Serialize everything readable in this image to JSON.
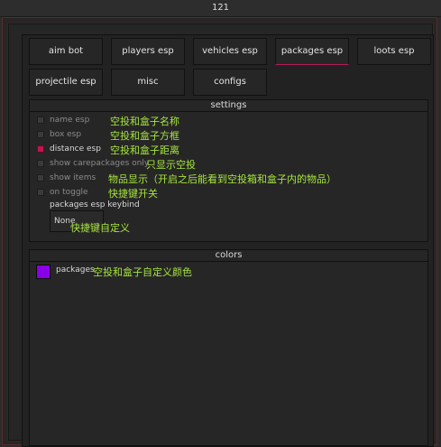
{
  "window": {
    "title": "121"
  },
  "tabs": [
    {
      "label": "aim bot"
    },
    {
      "label": "players esp"
    },
    {
      "label": "vehicles esp"
    },
    {
      "label": "packages esp",
      "active": true
    },
    {
      "label": "loots esp"
    },
    {
      "label": "projectile esp"
    },
    {
      "label": "misc"
    },
    {
      "label": "configs"
    }
  ],
  "settings": {
    "title": "settings",
    "items": [
      {
        "label": "name esp",
        "checked": false,
        "annotation": "空投和盒子名称"
      },
      {
        "label": "box esp",
        "checked": false,
        "annotation": "空投和盒子方框"
      },
      {
        "label": "distance esp",
        "checked": true,
        "annotation": "空投和盒子距离"
      },
      {
        "label": "show carepackages only",
        "checked": false,
        "annotation": "只显示空投"
      },
      {
        "label": "show items",
        "checked": false,
        "annotation": "物品显示（开启之后能看到空投箱和盒子内的物品）"
      },
      {
        "label": "on toggle",
        "checked": false,
        "annotation": "快捷键开关"
      }
    ],
    "keybind": {
      "label": "packages esp keybind",
      "value": "None",
      "annotation": "快捷键自定义"
    }
  },
  "colors": {
    "title": "colors",
    "items": [
      {
        "label": "packages",
        "color": "#8a00e6",
        "annotation": "空投和盒子自定义颜色"
      }
    ]
  },
  "theme": {
    "accent": "#c2144f",
    "annotation_color": "#a7e63e"
  }
}
